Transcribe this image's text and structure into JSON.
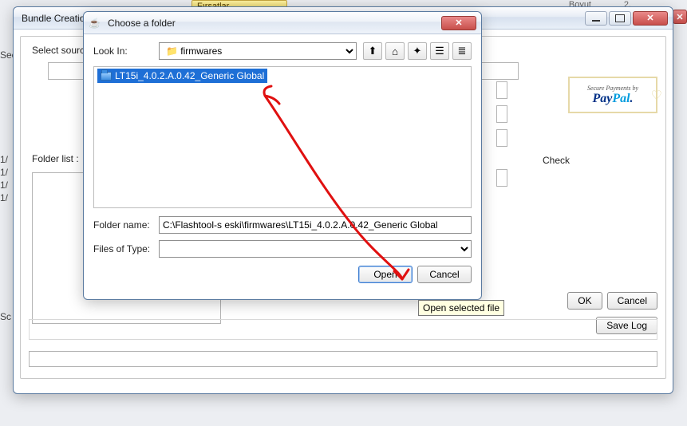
{
  "bundle": {
    "title": "Bundle Creation",
    "select_source_label": "Select source",
    "folder_list_label": "Folder list :",
    "ok_label": "OK",
    "cancel_label": "Cancel",
    "save_log_label": "Save Log",
    "check_label": "Check"
  },
  "paypal": {
    "secure": "Secure Payments by",
    "brand_pay": "Pay",
    "brand_pal": "Pal"
  },
  "dialog": {
    "title": "Choose a folder",
    "look_in_label": "Look In:",
    "look_in_value": "firmwares",
    "file_item": "LT15i_4.0.2.A.0.42_Generic Global",
    "folder_name_label": "Folder name:",
    "folder_name_value": "C:\\Flashtool-s eski\\firmwares\\LT15i_4.0.2.A.0.42_Generic Global",
    "files_type_label": "Files of Type:",
    "files_type_value": "",
    "open_label": "Open",
    "cancel_label": "Cancel",
    "tooltip": "Open selected file"
  },
  "icons": {
    "up": "⬆",
    "home": "⌂",
    "newf": "✦",
    "list": "☰",
    "details": "≣"
  },
  "trunc": [
    "1/",
    "1/",
    "1/",
    "1/"
  ],
  "misc": {
    "firsatlar": "Fırsatlar",
    "boyut": "Boyut",
    "two": "2.",
    "sec": "Sec",
    "sc": "Sc"
  }
}
